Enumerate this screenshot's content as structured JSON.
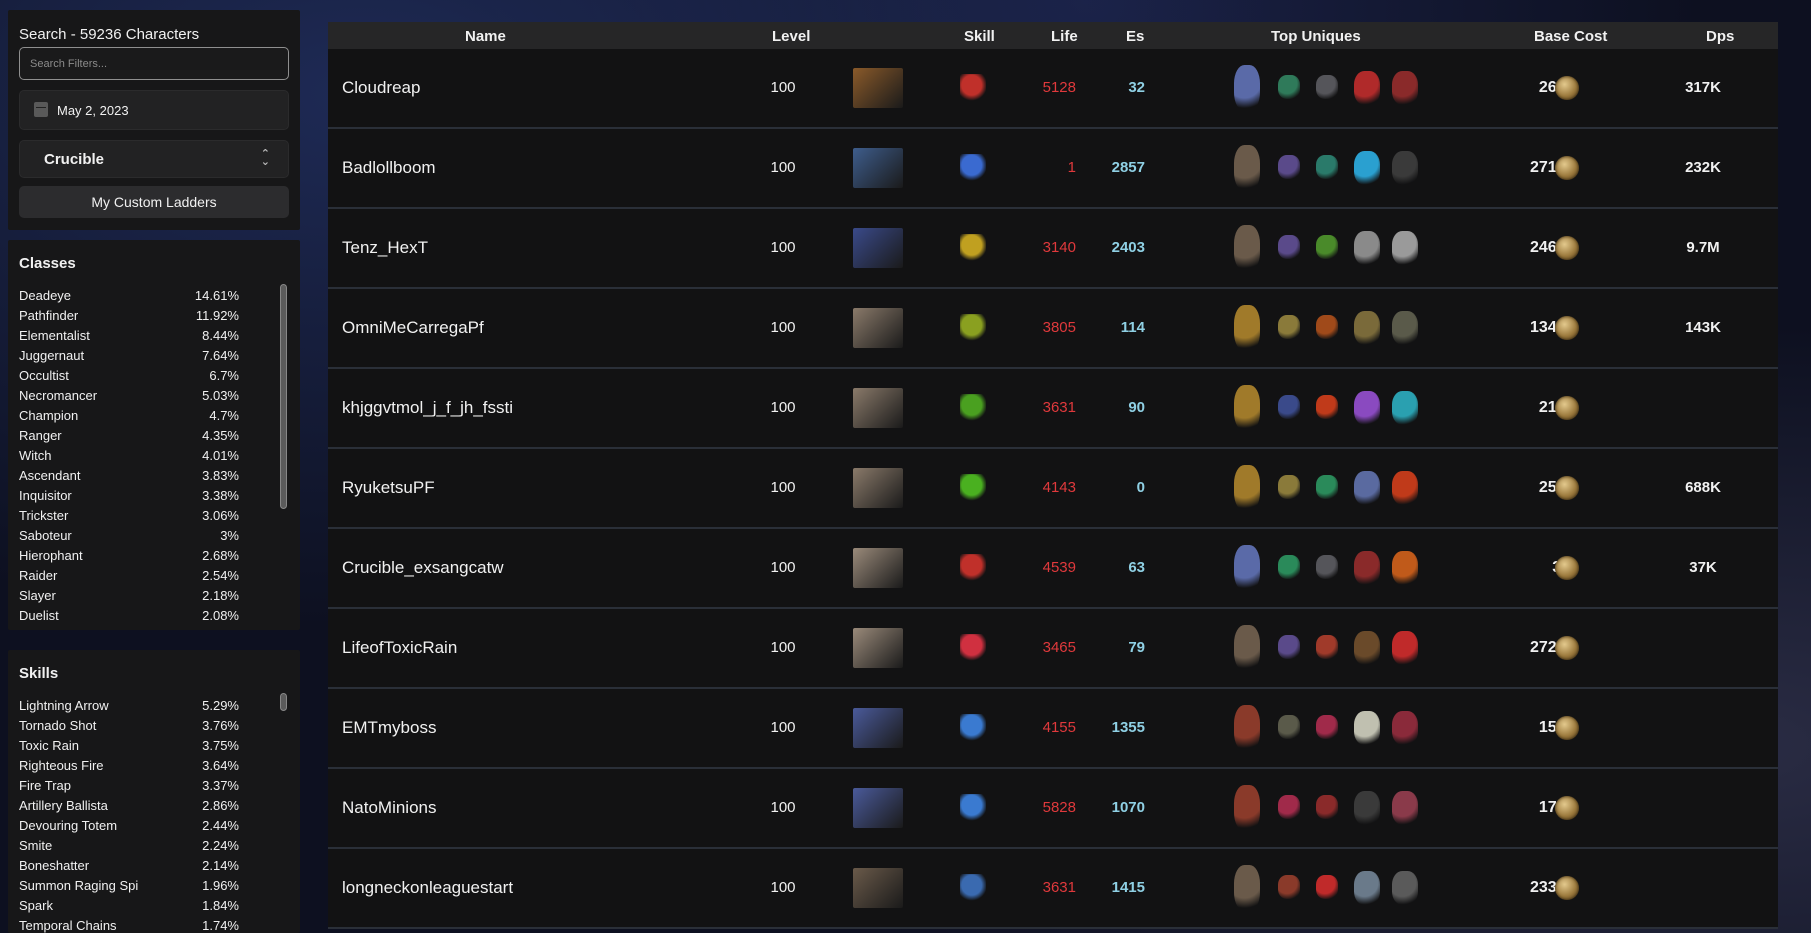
{
  "sidebar": {
    "search_title": "Search - 59236 Characters",
    "search_placeholder": "Search Filters...",
    "date": "May 2, 2023",
    "league": "Crucible",
    "custom_ladders": "My Custom Ladders",
    "classes_heading": "Classes",
    "classes": [
      {
        "name": "Deadeye",
        "pct": "14.61%"
      },
      {
        "name": "Pathfinder",
        "pct": "11.92%"
      },
      {
        "name": "Elementalist",
        "pct": "8.44%"
      },
      {
        "name": "Juggernaut",
        "pct": "7.64%"
      },
      {
        "name": "Occultist",
        "pct": "6.7%"
      },
      {
        "name": "Necromancer",
        "pct": "5.03%"
      },
      {
        "name": "Champion",
        "pct": "4.7%"
      },
      {
        "name": "Ranger",
        "pct": "4.35%"
      },
      {
        "name": "Witch",
        "pct": "4.01%"
      },
      {
        "name": "Ascendant",
        "pct": "3.83%"
      },
      {
        "name": "Inquisitor",
        "pct": "3.38%"
      },
      {
        "name": "Trickster",
        "pct": "3.06%"
      },
      {
        "name": "Saboteur",
        "pct": "3%"
      },
      {
        "name": "Hierophant",
        "pct": "2.68%"
      },
      {
        "name": "Raider",
        "pct": "2.54%"
      },
      {
        "name": "Slayer",
        "pct": "2.18%"
      },
      {
        "name": "Duelist",
        "pct": "2.08%"
      }
    ],
    "skills_heading": "Skills",
    "skills": [
      {
        "name": "Lightning Arrow",
        "pct": "5.29%"
      },
      {
        "name": "Tornado Shot",
        "pct": "3.76%"
      },
      {
        "name": "Toxic Rain",
        "pct": "3.75%"
      },
      {
        "name": "Righteous Fire",
        "pct": "3.64%"
      },
      {
        "name": "Fire Trap",
        "pct": "3.37%"
      },
      {
        "name": "Artillery Ballista",
        "pct": "2.86%"
      },
      {
        "name": "Devouring Totem",
        "pct": "2.44%"
      },
      {
        "name": "Smite",
        "pct": "2.24%"
      },
      {
        "name": "Boneshatter",
        "pct": "2.14%"
      },
      {
        "name": "Summon Raging Spi",
        "pct": "1.96%"
      },
      {
        "name": "Spark",
        "pct": "1.84%"
      },
      {
        "name": "Temporal Chains",
        "pct": "1.74%"
      }
    ]
  },
  "table": {
    "headers": {
      "name": "Name",
      "level": "Level",
      "skill": "Skill",
      "life": "Life",
      "es": "Es",
      "uniques": "Top Uniques",
      "cost": "Base Cost",
      "dps": "Dps"
    },
    "rows": [
      {
        "name": "Cloudreap",
        "level": "100",
        "life": "5128",
        "es": "32",
        "cost": "26.2",
        "dps": "317K",
        "portrait": "#8a5a2a",
        "skill": "#c0302a",
        "uniques": [
          "#5a6aa8",
          "#2f7a5a",
          "#55555a",
          "#b02a2a",
          "#8a2a2a"
        ]
      },
      {
        "name": "Badlollboom",
        "level": "100",
        "life": "1",
        "es": "2857",
        "cost": "271.8",
        "dps": "232K",
        "portrait": "#3e5d8c",
        "skill": "#3a6ad0",
        "uniques": [
          "#6a5a4a",
          "#5a4a8a",
          "#2a7a6a",
          "#2aa0d0",
          "#3a3a3a"
        ]
      },
      {
        "name": "Tenz_HexT",
        "level": "100",
        "life": "3140",
        "es": "2403",
        "cost": "246.5",
        "dps": "9.7M",
        "portrait": "#3a4a8a",
        "skill": "#c0a020",
        "uniques": [
          "#6a5a4a",
          "#5a4a8a",
          "#4a8a2a",
          "#8a8a8a",
          "#9a9a9a"
        ]
      },
      {
        "name": "OmniMeCarregaPf",
        "level": "100",
        "life": "3805",
        "es": "114",
        "cost": "134.1",
        "dps": "143K",
        "portrait": "#8a7a6a",
        "skill": "#8aa020",
        "uniques": [
          "#a07a2a",
          "#8a7a3a",
          "#a04a1a",
          "#7a6a3a",
          "#5a5a4a"
        ]
      },
      {
        "name": "khjggvtmol_j_f_jh_fssti",
        "level": "100",
        "life": "3631",
        "es": "90",
        "cost": "21.9",
        "dps": "",
        "portrait": "#8a7a6a",
        "skill": "#4aa020",
        "uniques": [
          "#a07a2a",
          "#3a4a8a",
          "#c03a1a",
          "#8a4ac0",
          "#2aa0b0"
        ]
      },
      {
        "name": "RyuketsuPF",
        "level": "100",
        "life": "4143",
        "es": "0",
        "cost": "25.1",
        "dps": "688K",
        "portrait": "#8a7a6a",
        "skill": "#4ab020",
        "uniques": [
          "#a07a2a",
          "#8a7a3a",
          "#2a8a5a",
          "#5a6aa0",
          "#c03a1a"
        ]
      },
      {
        "name": "Crucible_exsangcatw",
        "level": "100",
        "life": "4539",
        "es": "63",
        "cost": "33",
        "dps": "37K",
        "portrait": "#9a8a7a",
        "skill": "#c0302a",
        "uniques": [
          "#5a6aa8",
          "#2a8a5a",
          "#55555a",
          "#8a2a2a",
          "#c05a1a"
        ]
      },
      {
        "name": "LifeofToxicRain",
        "level": "100",
        "life": "3465",
        "es": "79",
        "cost": "272.9",
        "dps": "",
        "portrait": "#9a8a7a",
        "skill": "#d03040",
        "uniques": [
          "#6a5a4a",
          "#5a4a8a",
          "#a03a2a",
          "#6a4a2a",
          "#c02a2a"
        ]
      },
      {
        "name": "EMTmyboss",
        "level": "100",
        "life": "4155",
        "es": "1355",
        "cost": "15.9",
        "dps": "",
        "portrait": "#4a5a9a",
        "skill": "#3a7ad0",
        "uniques": [
          "#8a3a2a",
          "#5a5a4a",
          "#a02a4a",
          "#c0c0b0",
          "#8a2a3a"
        ]
      },
      {
        "name": "NatoMinions",
        "level": "100",
        "life": "5828",
        "es": "1070",
        "cost": "17.2",
        "dps": "",
        "portrait": "#4a5a9a",
        "skill": "#3a7ad0",
        "uniques": [
          "#8a3a2a",
          "#a02a4a",
          "#8a2a2a",
          "#3a3a3a",
          "#8a3a4a"
        ]
      },
      {
        "name": "longneckonleaguestart",
        "level": "100",
        "life": "3631",
        "es": "1415",
        "cost": "233.4",
        "dps": "",
        "portrait": "#6a5a4a",
        "skill": "#3a6ab0",
        "uniques": [
          "#6a5a4a",
          "#8a3a2a",
          "#c02a2a",
          "#6a7a8a",
          "#5a5a5a"
        ]
      }
    ]
  }
}
